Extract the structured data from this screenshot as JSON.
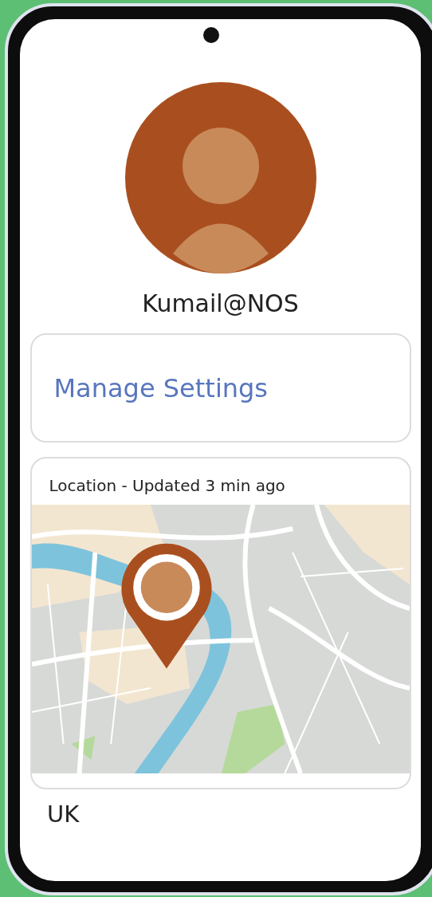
{
  "profile": {
    "username": "Kumail@NOS"
  },
  "settings_card": {
    "label": "Manage Settings"
  },
  "location_card": {
    "title": "Location - Updated 3 min ago"
  },
  "country": "UK"
}
